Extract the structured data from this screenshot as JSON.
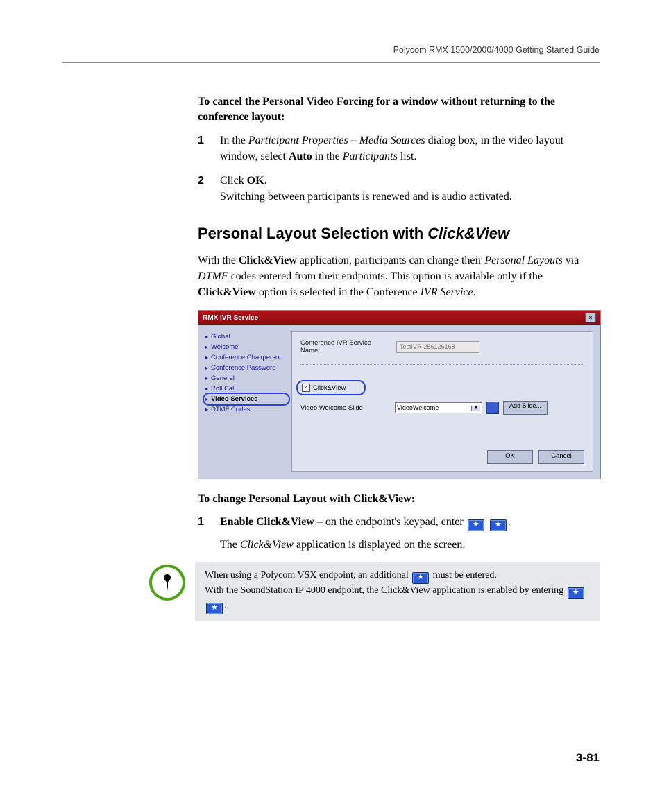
{
  "running_head": "Polycom RMX 1500/2000/4000 Getting Started Guide",
  "intro_bold": "To cancel the Personal Video Forcing for a window without returning to the conference layout:",
  "steps_a": [
    {
      "num": "1",
      "pre": "In the ",
      "it1": "Participant Properties – Media Sources",
      "mid1": " dialog box, in the video layout window, select ",
      "b1": "Auto",
      "mid2": " in the ",
      "it2": "Participants",
      "post": " list."
    },
    {
      "num": "2",
      "pre": "Click ",
      "b1": "OK",
      "post": ".",
      "line2": "Switching between participants is renewed and is audio activated."
    }
  ],
  "h2_pre": "Personal Layout Selection with ",
  "h2_it": "Click&View",
  "para1": {
    "pre": "With the ",
    "b1": "Click&View",
    "mid1": " application, participants can change their ",
    "it1": "Personal Layouts",
    "mid2": " via ",
    "it2": "DTMF",
    "mid3": " codes entered from their endpoints. This option is available only if the ",
    "b2": "Click&View",
    "mid4": " option is selected in the Conference ",
    "it3": "IVR Service",
    "post": "."
  },
  "dialog": {
    "title": "RMX IVR Service",
    "nav": [
      "Global",
      "Welcome",
      "Conference Chairperson",
      "Conference Password",
      "General",
      "Roll Call",
      "Video Services",
      "DTMF Codes"
    ],
    "nav_selected": "Video Services",
    "svc_label": "Conference IVR Service Name:",
    "svc_value": "TestIVR-256126168",
    "cb_label": "Click&View",
    "slide_label": "Video Welcome Slide:",
    "slide_value": "VideoWelcome",
    "add_btn": "Add Slide...",
    "ok": "OK",
    "cancel": "Cancel"
  },
  "change_heading": "To change Personal Layout with Click&View:",
  "steps_b": [
    {
      "num": "1",
      "b1": "Enable Click&View",
      "mid": " – on the endpoint's keypad, enter ",
      "post": ".",
      "line2_pre": "The ",
      "line2_it": "Click&View",
      "line2_post": " application is displayed on the screen."
    }
  ],
  "note": {
    "line1_pre": "When using a Polycom VSX endpoint, an additional ",
    "line1_post": " must be entered.",
    "line2": "With the SoundStation IP 4000 endpoint, the Click&View application is enabled by entering ",
    "line2_post": "."
  },
  "page_num": "3-81"
}
